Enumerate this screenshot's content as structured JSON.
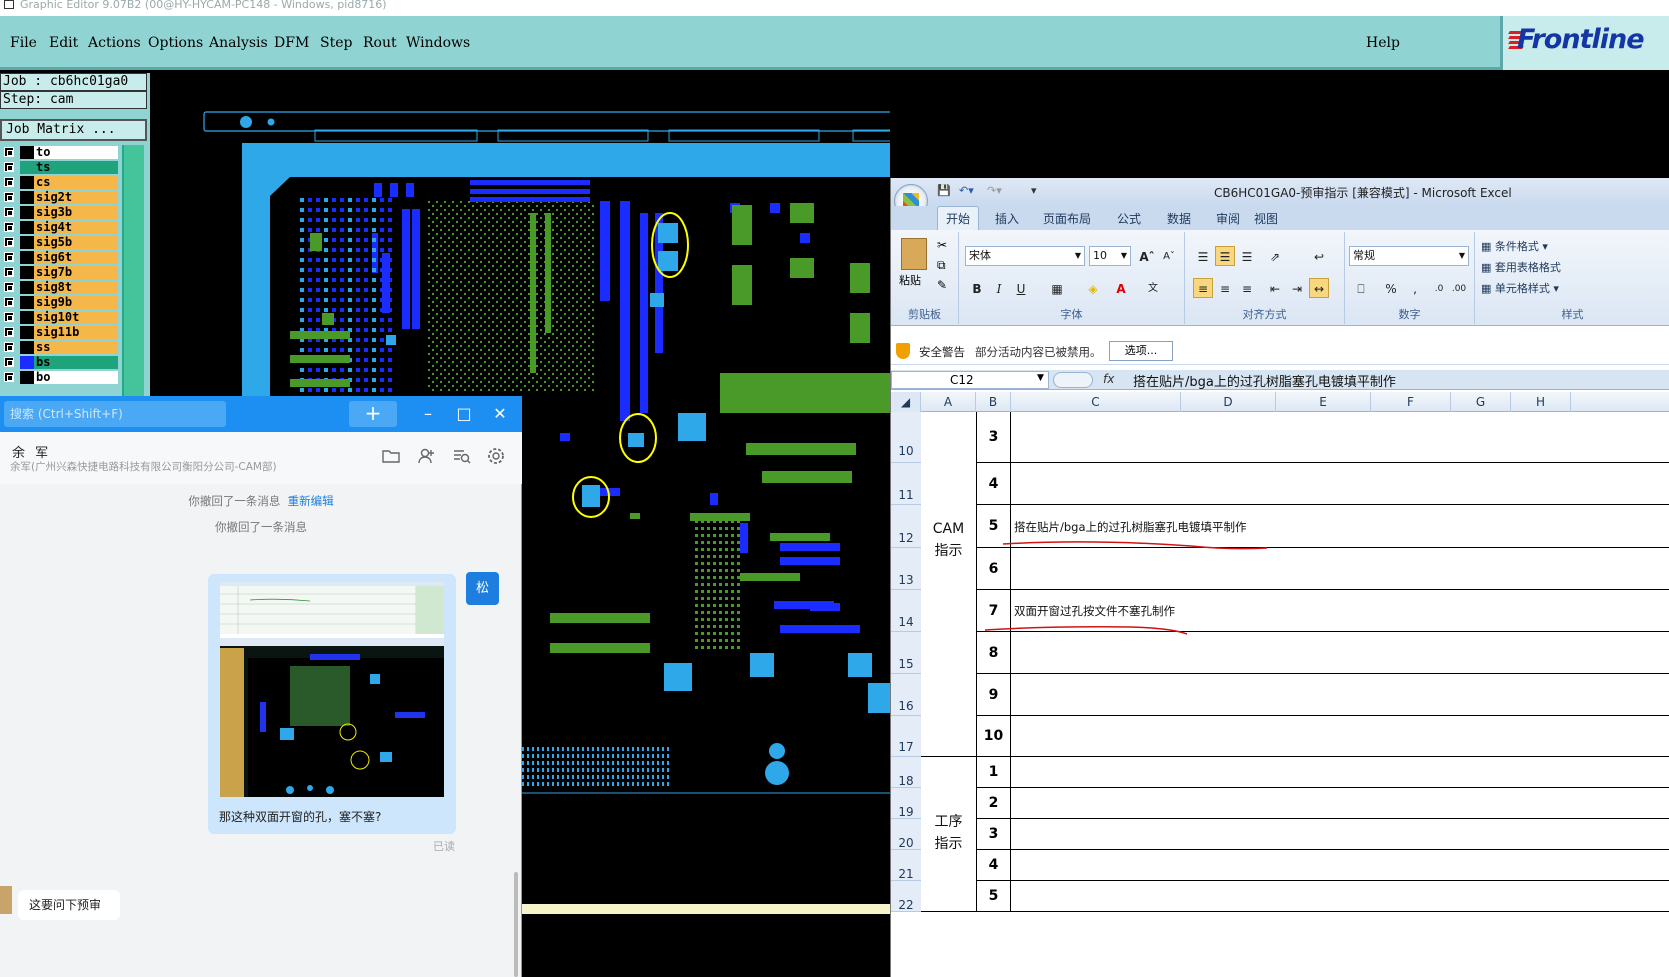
{
  "window": {
    "title": "Graphic Editor 9.07B2 (00@HY-HYCAM-PC148 - Windows, pid8716)"
  },
  "menubar": {
    "items": [
      "File",
      "Edit",
      "Actions",
      "Options",
      "Analysis",
      "DFM",
      "Step",
      "Rout",
      "Windows"
    ],
    "help": "Help",
    "logo": "Frontline"
  },
  "job": {
    "job_line": "Job : cb6hc01ga0",
    "step_line": "Step: cam",
    "matrix_button": "Job Matrix ..."
  },
  "layers": [
    {
      "name": "to",
      "bg": "#ffffff",
      "swatch": "#000000"
    },
    {
      "name": "ts",
      "bg": "#1fa37d",
      "swatch": "#1fa37d"
    },
    {
      "name": "cs",
      "bg": "#f5b74a",
      "swatch": "#000000"
    },
    {
      "name": "sig2t",
      "bg": "#f5b74a",
      "swatch": "#000000"
    },
    {
      "name": "sig3b",
      "bg": "#f5b74a",
      "swatch": "#000000"
    },
    {
      "name": "sig4t",
      "bg": "#f5b74a",
      "swatch": "#000000"
    },
    {
      "name": "sig5b",
      "bg": "#f5b74a",
      "swatch": "#000000"
    },
    {
      "name": "sig6t",
      "bg": "#f5b74a",
      "swatch": "#000000"
    },
    {
      "name": "sig7b",
      "bg": "#f5b74a",
      "swatch": "#000000"
    },
    {
      "name": "sig8t",
      "bg": "#f5b74a",
      "swatch": "#000000"
    },
    {
      "name": "sig9b",
      "bg": "#f5b74a",
      "swatch": "#000000"
    },
    {
      "name": "sig10t",
      "bg": "#f5b74a",
      "swatch": "#000000"
    },
    {
      "name": "sig11b",
      "bg": "#f5b74a",
      "swatch": "#000000"
    },
    {
      "name": "ss",
      "bg": "#f5b74a",
      "swatch": "#000000"
    },
    {
      "name": "bs",
      "bg": "#1fa37d",
      "swatch": "#1a2cff"
    },
    {
      "name": "bo",
      "bg": "#ffffff",
      "swatch": "#000000"
    }
  ],
  "chat": {
    "search_placeholder": "搜索 (Ctrl+Shift+F)",
    "add": "+",
    "contact_name": "余 军",
    "contact_sub": "余军(广州兴森快捷电路科技有限公司衡阳分公司-CAM部)",
    "system_msg_1": "你撤回了一条消息",
    "system_msg_1_link": "重新编辑",
    "system_msg_2": "你撤回了一条消息",
    "bubble_text": "那这种双面开窗的孔，塞不塞?",
    "avatar_me": "松",
    "read_status": "已读",
    "incoming_text": "这要问下预审"
  },
  "excel": {
    "title": "CB6HC01GA0-预审指示  [兼容模式] - Microsoft Excel",
    "tabs": [
      "开始",
      "插入",
      "页面布局",
      "公式",
      "数据",
      "审阅",
      "视图"
    ],
    "ribbon": {
      "paste": "粘贴",
      "clipboard": "剪贴板",
      "font_name": "宋体",
      "font_size": "10",
      "font_group": "字体",
      "align_group": "对齐方式",
      "number_format": "常规",
      "number_group": "数字",
      "styles": [
        "条件格式",
        "套用表格格式",
        "单元格样式"
      ],
      "styles_group": "样式"
    },
    "security": {
      "warning": "安全警告",
      "text": "部分活动内容已被禁用。",
      "options": "选项..."
    },
    "namebox": "C12",
    "formula": "搭在贴片/bga上的过孔树脂塞孔电镀填平制作",
    "columns": [
      "A",
      "B",
      "C",
      "D",
      "E",
      "F",
      "G",
      "H"
    ],
    "rows": [
      {
        "num": "10",
        "b": "3",
        "c": ""
      },
      {
        "num": "11",
        "b": "4",
        "c": ""
      },
      {
        "num": "12",
        "b": "5",
        "c": "搭在贴片/bga上的过孔树脂塞孔电镀填平制作"
      },
      {
        "num": "13",
        "b": "6",
        "c": ""
      },
      {
        "num": "14",
        "b": "7",
        "c": "双面开窗过孔按文件不塞孔制作"
      },
      {
        "num": "15",
        "b": "8",
        "c": ""
      },
      {
        "num": "16",
        "b": "9",
        "c": ""
      },
      {
        "num": "17",
        "b": "10",
        "c": ""
      },
      {
        "num": "18",
        "b": "1",
        "c": ""
      },
      {
        "num": "19",
        "b": "2",
        "c": ""
      },
      {
        "num": "20",
        "b": "3",
        "c": ""
      },
      {
        "num": "21",
        "b": "4",
        "c": ""
      },
      {
        "num": "22",
        "b": "5",
        "c": ""
      }
    ],
    "merged_a1": [
      "CAM",
      "指示"
    ],
    "merged_a2": [
      "工序",
      "指示"
    ]
  }
}
